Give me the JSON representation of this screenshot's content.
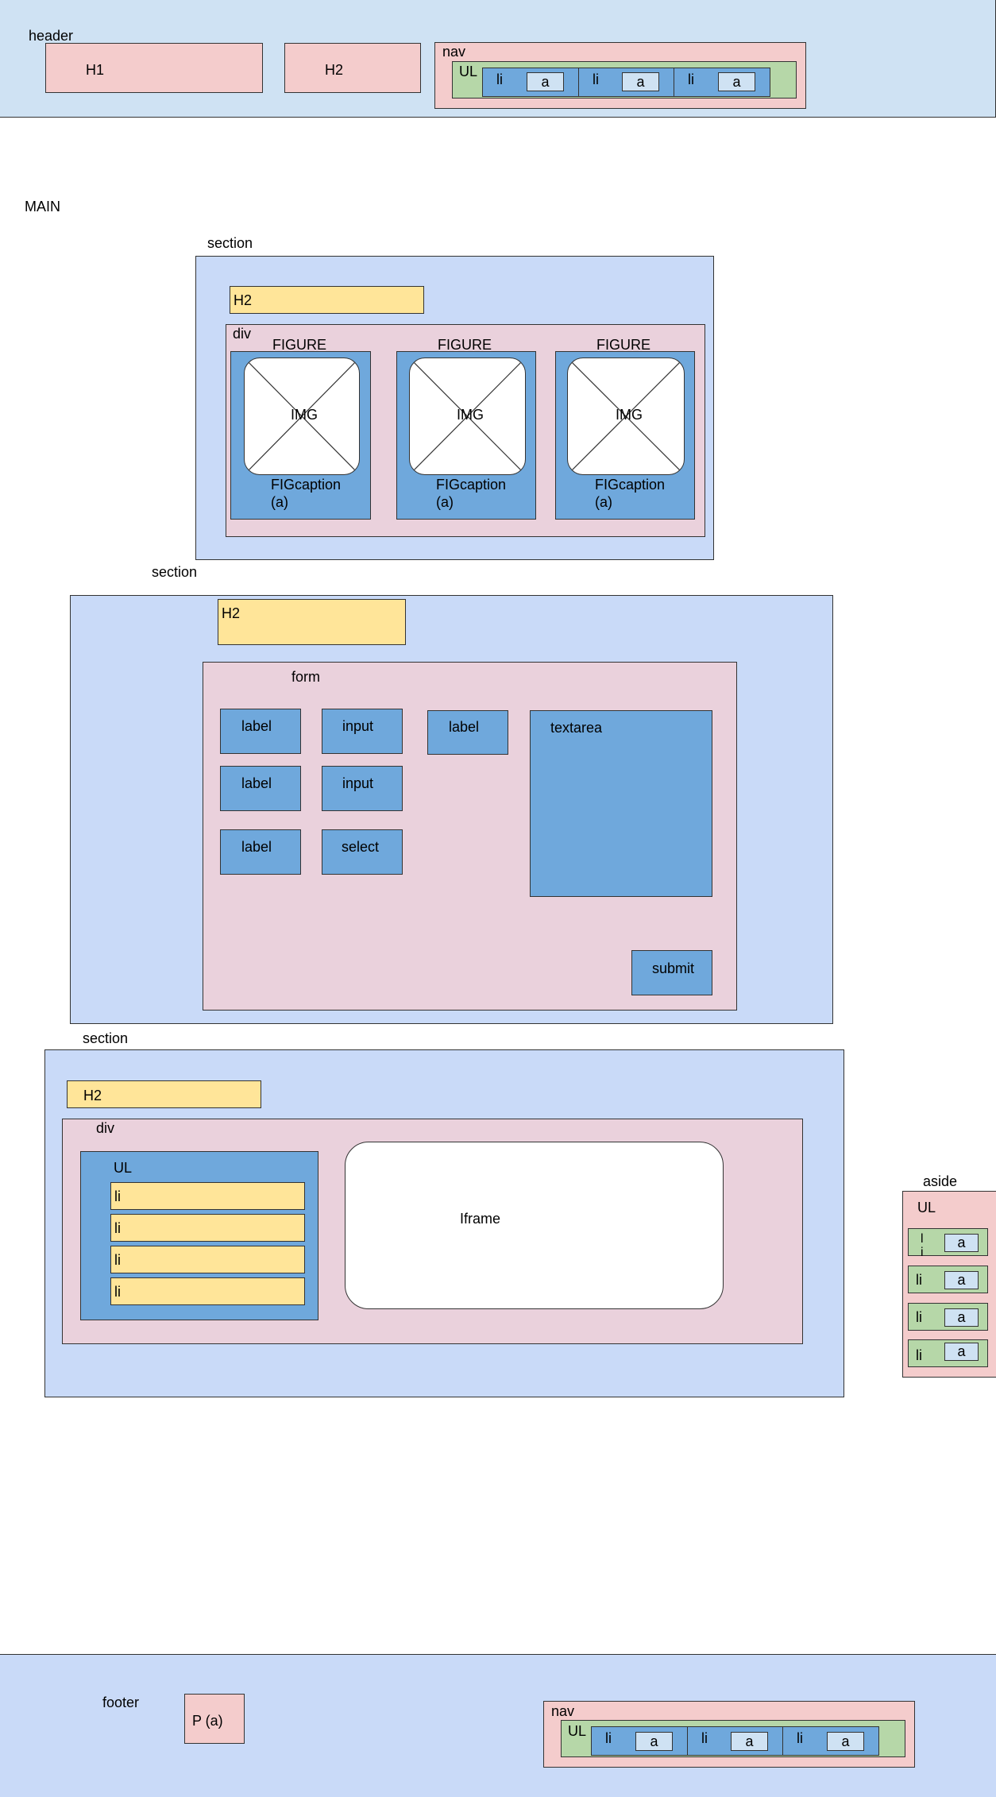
{
  "header": {
    "label": "header",
    "h1": "H1",
    "h2": "H2",
    "nav": {
      "label": "nav",
      "ul": "UL",
      "items": [
        {
          "li": "li",
          "a": "a"
        },
        {
          "li": "li",
          "a": "a"
        },
        {
          "li": "li",
          "a": "a"
        }
      ]
    }
  },
  "main": {
    "label": "MAIN"
  },
  "section1": {
    "label": "section",
    "h2": "H2",
    "div": "div",
    "figures": [
      {
        "figure": "FIGURE",
        "img": "IMG",
        "caption": "FIGcaption",
        "caption_a": "(a)"
      },
      {
        "figure": "FIGURE",
        "img": "IMG",
        "caption": "FIGcaption",
        "caption_a": "(a)"
      },
      {
        "figure": "FIGURE",
        "img": "IMG",
        "caption": "FIGcaption",
        "caption_a": "(a)"
      }
    ]
  },
  "section2": {
    "label": "section",
    "h2": "H2",
    "form": {
      "label": "form",
      "label1": "label",
      "input1": "input",
      "label_ta": "label",
      "textarea": "textarea",
      "label2": "label",
      "input2": "input",
      "label3": "label",
      "select": "select",
      "submit": "submit"
    }
  },
  "section3": {
    "label": "section",
    "h2": "H2",
    "div": "div",
    "ul": {
      "label": "UL",
      "items": [
        "li",
        "li",
        "li",
        "li"
      ]
    },
    "iframe": "Iframe"
  },
  "aside": {
    "label": "aside",
    "ul": "UL",
    "items": [
      {
        "li": "l\ni",
        "a": "a"
      },
      {
        "li": "li",
        "a": "a"
      },
      {
        "li": "li",
        "a": "a"
      },
      {
        "li": "li",
        "a": "a"
      }
    ]
  },
  "footer": {
    "label": "footer",
    "p": "P (a)",
    "nav": {
      "label": "nav",
      "ul": "UL",
      "items": [
        {
          "li": "li",
          "a": "a"
        },
        {
          "li": "li",
          "a": "a"
        },
        {
          "li": "li",
          "a": "a"
        }
      ]
    }
  }
}
